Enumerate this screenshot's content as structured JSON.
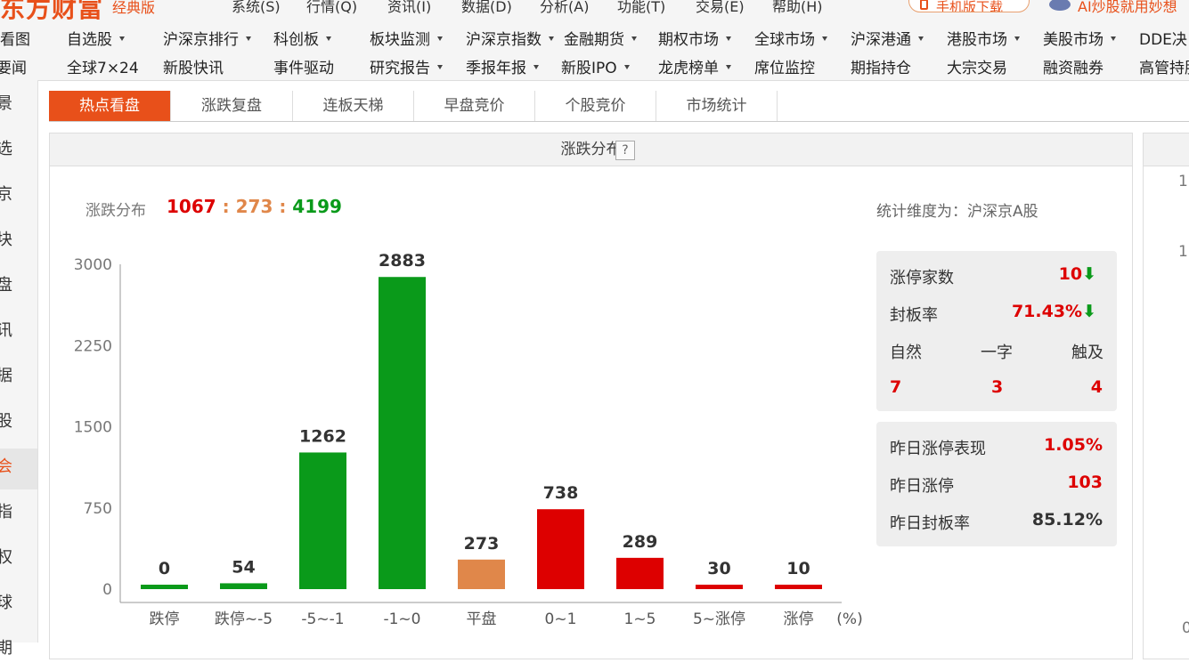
{
  "app": {
    "logo": "东方财富",
    "edition": "经典版"
  },
  "top_menu": [
    "系统(S)",
    "行情(Q)",
    "资讯(I)",
    "数据(D)",
    "分析(A)",
    "功能(T)",
    "交易(E)",
    "帮助(H)"
  ],
  "mobile_button": "手机版下载",
  "ai_link": "AI炒股就用妙想",
  "nav": {
    "row1": [
      {
        "label": "看图",
        "dd": false
      },
      {
        "label": "自选股",
        "dd": true
      },
      {
        "label": "沪深京排行",
        "dd": true
      },
      {
        "label": "科创板",
        "dd": true
      },
      {
        "label": "板块监测",
        "dd": true
      },
      {
        "label": "沪深京指数",
        "dd": true
      },
      {
        "label": "金融期货",
        "dd": true
      },
      {
        "label": "期权市场",
        "dd": true
      },
      {
        "label": "全球市场",
        "dd": true
      },
      {
        "label": "沪深港通",
        "dd": true
      },
      {
        "label": "港股市场",
        "dd": true
      },
      {
        "label": "美股市场",
        "dd": true
      },
      {
        "label": "DDE决",
        "dd": false
      }
    ],
    "row2": [
      {
        "label": "要闻",
        "dd": false
      },
      {
        "label": "全球7×24",
        "dd": false
      },
      {
        "label": "新股快讯",
        "dd": false
      },
      {
        "label": "事件驱动",
        "dd": false
      },
      {
        "label": "研究报告",
        "dd": true
      },
      {
        "label": "季报年报",
        "dd": true
      },
      {
        "label": "新股IPO",
        "dd": true
      },
      {
        "label": "龙虎榜单",
        "dd": true
      },
      {
        "label": "席位监控",
        "dd": false
      },
      {
        "label": "期指持仓",
        "dd": false
      },
      {
        "label": "大宗交易",
        "dd": false
      },
      {
        "label": "融资融券",
        "dd": false
      },
      {
        "label": "高管持股",
        "dd": false
      }
    ]
  },
  "sidebar": [
    "景",
    "选",
    "京",
    "块",
    "盘",
    "讯",
    "据",
    "股",
    "会",
    "指",
    "权",
    "球",
    "期"
  ],
  "tabs": [
    "热点看盘",
    "涨跌复盘",
    "连板天梯",
    "早盘竞价",
    "个股竞价",
    "市场统计"
  ],
  "panel": {
    "title": "涨跌分布",
    "help": "?",
    "summary_label": "涨跌分布",
    "summary": {
      "up": "1067",
      "flat": "273",
      "down": "4199"
    },
    "dimension": "统计维度为：沪深京A股"
  },
  "stats": {
    "limit_up_count_label": "涨停家数",
    "limit_up_count": "10",
    "seal_rate_label": "封板率",
    "seal_rate": "71.43%",
    "cols": [
      "自然",
      "一字",
      "触及"
    ],
    "col_vals": [
      "7",
      "3",
      "4"
    ],
    "y_perf_label": "昨日涨停表现",
    "y_perf": "1.05%",
    "y_limit_label": "昨日涨停",
    "y_limit": "103",
    "y_seal_label": "昨日封板率",
    "y_seal": "85.12%"
  },
  "right_panel_ticks": [
    "1",
    "1",
    "0"
  ],
  "chart_data": {
    "type": "bar",
    "categories": [
      "跌停",
      "跌停~-5",
      "-5~-1",
      "-1~0",
      "平盘",
      "0~1",
      "1~5",
      "5~涨停",
      "涨停"
    ],
    "values": [
      0,
      54,
      1262,
      2883,
      273,
      738,
      289,
      30,
      10
    ],
    "colors": [
      "#0a9a1a",
      "#0a9a1a",
      "#0a9a1a",
      "#0a9a1a",
      "#e0874a",
      "#dd0000",
      "#dd0000",
      "#dd0000",
      "#dd0000"
    ],
    "yticks": [
      0,
      750,
      1500,
      2250,
      3000
    ],
    "ylim": [
      0,
      3000
    ],
    "x_unit": "(%)",
    "grid": false
  },
  "colors": {
    "accent": "#e8501a",
    "up": "#dd0000",
    "down": "#0a9a1a",
    "flat": "#e0874a"
  }
}
